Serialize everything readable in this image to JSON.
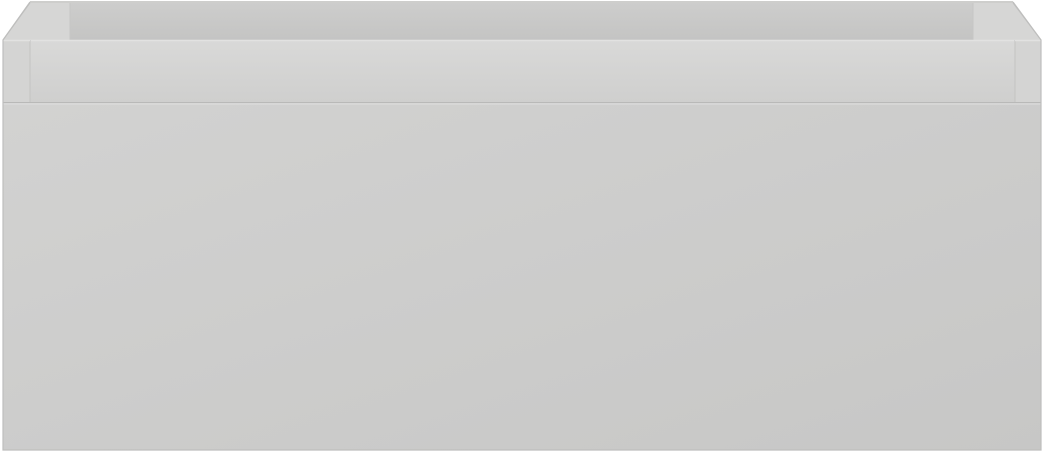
{
  "object": {
    "kind": "drawer-unit",
    "colors": {
      "front_light": "#d2d2d1",
      "front_dark": "#c7c7c6",
      "top_rim": "#d8d8d7",
      "back_wall": "#c9c9c8",
      "inner_side": "#d4d4d3",
      "edge_line": "#bdbdbc",
      "highlight": "#e3e3e2",
      "background": "#ffffff"
    }
  }
}
